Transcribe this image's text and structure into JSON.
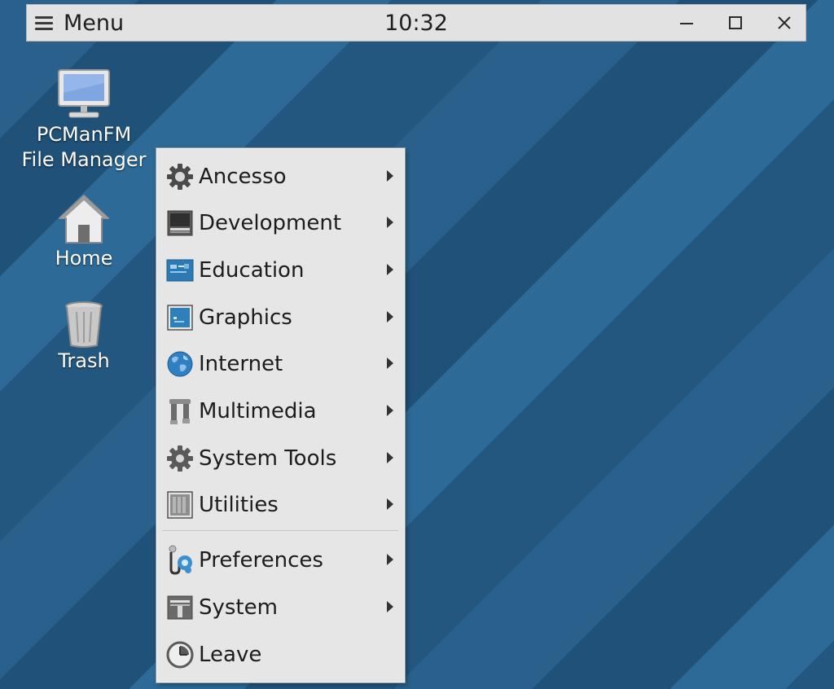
{
  "panel": {
    "menu_label": "Menu",
    "clock": "10:32",
    "controls": [
      "minimize-icon",
      "maximize-icon",
      "close-icon"
    ]
  },
  "desktop": {
    "icons": [
      {
        "label": "PCManFM\nFile Manager",
        "icon": "monitor-icon"
      },
      {
        "label": "Home",
        "icon": "home-icon"
      },
      {
        "label": "Trash",
        "icon": "trash-icon"
      }
    ]
  },
  "app_menu": {
    "items": [
      {
        "label": "Ancesso",
        "icon": "gear-icon",
        "submenu": true
      },
      {
        "label": "Development",
        "icon": "development-icon",
        "submenu": true
      },
      {
        "label": "Education",
        "icon": "education-icon",
        "submenu": true
      },
      {
        "label": "Graphics",
        "icon": "graphics-icon",
        "submenu": true
      },
      {
        "label": "Internet",
        "icon": "globe-icon",
        "submenu": true
      },
      {
        "label": "Multimedia",
        "icon": "multimedia-icon",
        "submenu": true
      },
      {
        "label": "System Tools",
        "icon": "gear-icon",
        "submenu": true
      },
      {
        "label": "Utilities",
        "icon": "utilities-icon",
        "submenu": true
      },
      {
        "label": "Preferences",
        "icon": "preferences-icon",
        "submenu": true
      },
      {
        "label": "System",
        "icon": "system-icon",
        "submenu": true
      },
      {
        "label": "Leave",
        "icon": "clock-icon",
        "submenu": false
      }
    ]
  },
  "colors": {
    "desktop_bg": "#265b84",
    "panel_bg": "#e2e2e2",
    "menu_bg": "#e6e6e6"
  }
}
